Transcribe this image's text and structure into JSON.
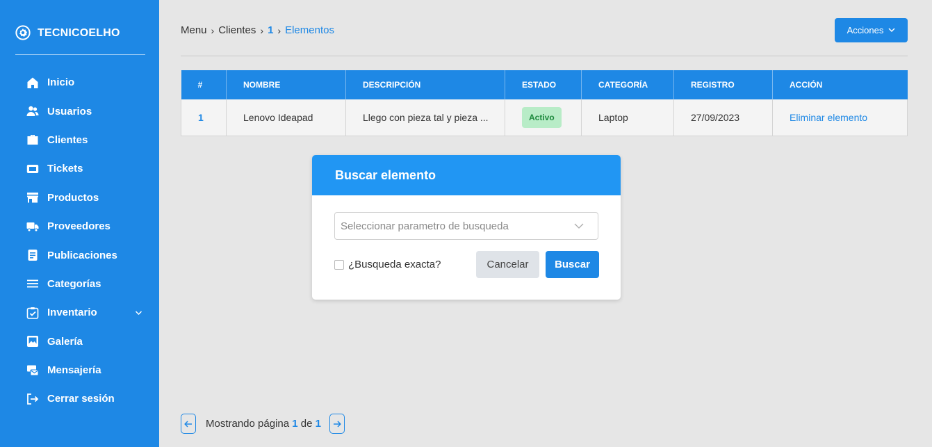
{
  "brand": {
    "name": "TECNICOELHO"
  },
  "sidebar": {
    "items": [
      {
        "label": "Inicio",
        "icon": "home-icon"
      },
      {
        "label": "Usuarios",
        "icon": "users-icon"
      },
      {
        "label": "Clientes",
        "icon": "briefcase-icon"
      },
      {
        "label": "Tickets",
        "icon": "ticket-icon"
      },
      {
        "label": "Productos",
        "icon": "store-icon"
      },
      {
        "label": "Proveedores",
        "icon": "truck-icon"
      },
      {
        "label": "Publicaciones",
        "icon": "document-icon"
      },
      {
        "label": "Categorías",
        "icon": "list-icon"
      },
      {
        "label": "Inventario",
        "icon": "clipboard-check-icon"
      },
      {
        "label": "Galería",
        "icon": "image-icon"
      },
      {
        "label": "Mensajería",
        "icon": "message-icon"
      },
      {
        "label": "Cerrar sesión",
        "icon": "logout-icon"
      }
    ]
  },
  "breadcrumb": {
    "menu": "Menu",
    "clients": "Clientes",
    "id": "1",
    "current": "Elementos"
  },
  "header": {
    "actions_label": "Acciones"
  },
  "table": {
    "headers": [
      "#",
      "NOMBRE",
      "DESCRIPCIÓN",
      "ESTADO",
      "CATEGORÍA",
      "REGISTRO",
      "ACCIÓN"
    ],
    "rows": [
      {
        "num": "1",
        "name": "Lenovo Ideapad",
        "description": "Llego con pieza tal y pieza ...",
        "status": "Activo",
        "category": "Laptop",
        "date": "27/09/2023",
        "action": "Eliminar elemento"
      }
    ]
  },
  "modal": {
    "title": "Buscar elemento",
    "select_placeholder": "Seleccionar parametro de busqueda",
    "checkbox_label": "¿Busqueda exacta?",
    "cancel_label": "Cancelar",
    "search_label": "Buscar"
  },
  "pagination": {
    "prefix": "Mostrando página",
    "current": "1",
    "of": "de",
    "total": "1"
  },
  "colors": {
    "primary": "#1e88e5",
    "modal_header": "#2196f3",
    "badge_bg": "#b8ecc7",
    "badge_text": "#1e8a3e"
  }
}
